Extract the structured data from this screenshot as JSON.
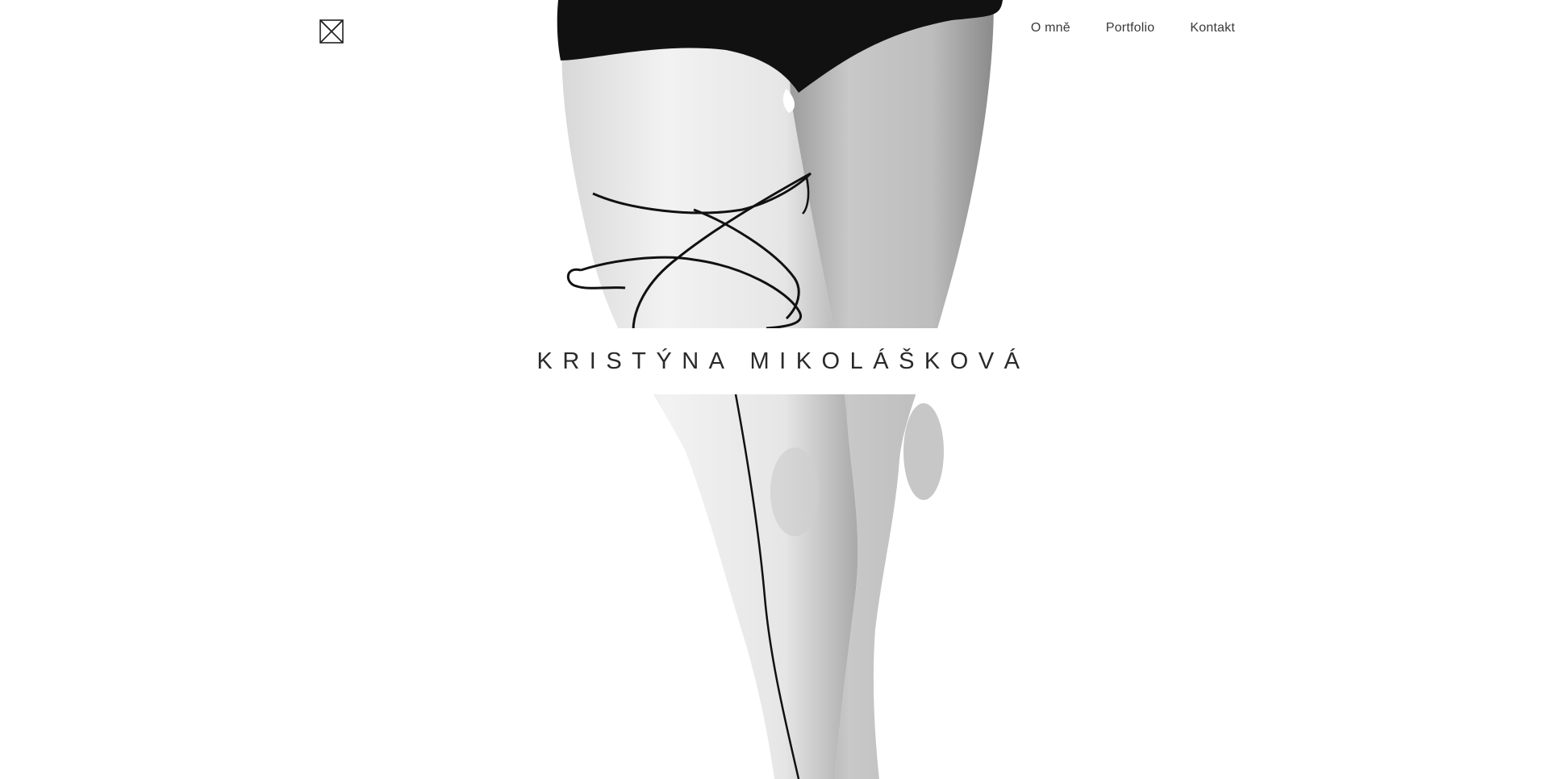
{
  "header": {
    "logo_icon": "bow-tie-square-logo-icon"
  },
  "nav": {
    "items": [
      {
        "label": "O mně"
      },
      {
        "label": "Portfolio"
      },
      {
        "label": "Kontakt"
      }
    ]
  },
  "hero": {
    "name": "KRISTÝNA MIKOLÁŠKOVÁ",
    "image_icon": "legs-with-thread-photo"
  },
  "colors": {
    "background": "#ffffff",
    "text": "#2a2a2a",
    "nav_text": "#3a3a3a"
  }
}
